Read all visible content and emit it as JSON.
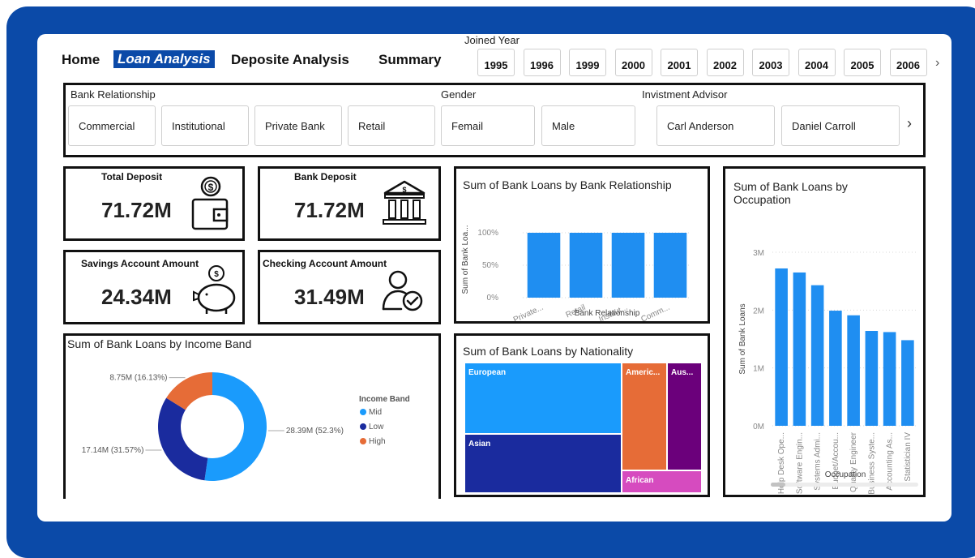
{
  "nav": {
    "home": "Home",
    "loan": "Loan Analysis",
    "deposit": "Deposite Analysis",
    "summary": "Summary"
  },
  "joined_year": {
    "label": "Joined Year",
    "years": [
      "1995",
      "1996",
      "1999",
      "2000",
      "2001",
      "2002",
      "2003",
      "2004",
      "2005",
      "2006"
    ]
  },
  "slicers": {
    "bank_relationship": {
      "label": "Bank Relationship",
      "options": [
        "Commercial",
        "Institutional",
        "Private Bank",
        "Retail"
      ]
    },
    "gender": {
      "label": "Gender",
      "options": [
        "Femail",
        "Male"
      ]
    },
    "advisor": {
      "label": "Invistment Advisor",
      "options": [
        "Carl Anderson",
        "Daniel Carroll"
      ]
    }
  },
  "kpis": {
    "total_deposit": {
      "title": "Total Deposit",
      "value": "71.72M"
    },
    "bank_deposit": {
      "title": "Bank Deposit",
      "value": "71.72M"
    },
    "savings": {
      "title": "Savings Account Amount",
      "value": "24.34M"
    },
    "checking": {
      "title": "Checking Account Amount",
      "value": "31.49M"
    }
  },
  "colors": {
    "brand": "#0b4aa8",
    "bar": "#1f8ef1",
    "mid": "#1a9bfc",
    "low": "#1a2b9e",
    "high": "#e66c37",
    "american": "#e66c37",
    "australian": "#6b007b",
    "african": "#d64bbf"
  },
  "chart_data": [
    {
      "id": "relationship",
      "type": "bar",
      "title": "Sum of Bank Loans by Bank Relationship",
      "xlabel": "Bank Relationship",
      "ylabel": "Sum of Bank Loa...",
      "categories": [
        "Private...",
        "Retail",
        "Institut...",
        "Comm..."
      ],
      "values": [
        100,
        100,
        100,
        100
      ],
      "ylim": [
        0,
        100
      ],
      "yticks": [
        "0%",
        "50%",
        "100%"
      ],
      "grid": true
    },
    {
      "id": "occupation",
      "type": "bar",
      "title": "Sum of Bank Loans by Occupation",
      "xlabel": "Occupation",
      "ylabel": "Sum of Bank Loans",
      "categories": [
        "Help Desk Ope...",
        "Software Engin...",
        "Systems Admi...",
        "Budget/Accou...",
        "Quality Engineer",
        "Business Syste...",
        "Accounting As...",
        "Statistician IV"
      ],
      "values": [
        2.72,
        2.65,
        2.43,
        1.99,
        1.91,
        1.64,
        1.62,
        1.48
      ],
      "ylim": [
        0,
        3
      ],
      "yticks": [
        "0M",
        "1M",
        "2M",
        "3M"
      ],
      "grid": true
    },
    {
      "id": "income",
      "type": "pie",
      "title": "Sum of Bank Loans by Income Band",
      "legend_title": "Income Band",
      "slices": [
        {
          "name": "Mid",
          "value": 52.3,
          "label": "28.39M (52.3%)"
        },
        {
          "name": "Low",
          "value": 31.57,
          "label": "17.14M (31.57%)"
        },
        {
          "name": "High",
          "value": 16.13,
          "label": "8.75M (16.13%)"
        }
      ]
    },
    {
      "id": "nationality",
      "type": "treemap",
      "title": "Sum of Bank Loans by Nationality",
      "items": [
        {
          "name": "European",
          "label": "European"
        },
        {
          "name": "Asian",
          "label": "Asian"
        },
        {
          "name": "American",
          "label": "Americ..."
        },
        {
          "name": "Australian",
          "label": "Aus..."
        },
        {
          "name": "African",
          "label": "African"
        }
      ]
    }
  ]
}
